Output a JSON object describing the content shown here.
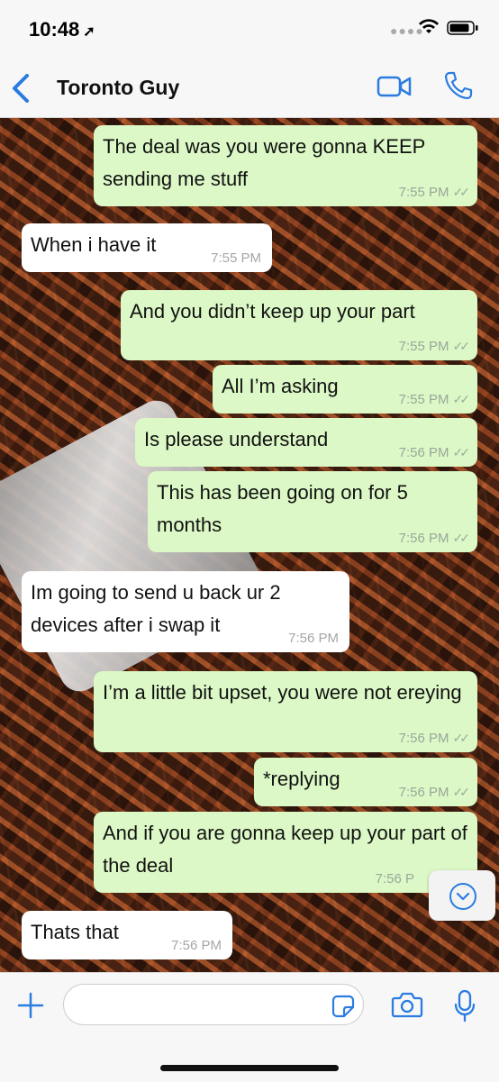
{
  "status": {
    "time": "10:48",
    "location_icon": "location-arrow-icon"
  },
  "header": {
    "title": "Toronto Guy",
    "back_icon": "chevron-left-icon",
    "video_icon": "video-call-icon",
    "call_icon": "phone-call-icon",
    "accent": "#2a7ce0"
  },
  "messages": [
    {
      "dir": "out",
      "text": "The deal was you were gonna KEEP sending me stuff",
      "time": "7:55 PM",
      "ticks": "✓✓"
    },
    {
      "dir": "in",
      "text": "When i have it",
      "time": "7:55 PM"
    },
    {
      "dir": "out",
      "text": "And you didn’t keep up your part",
      "time": "7:55 PM",
      "ticks": "✓✓"
    },
    {
      "dir": "out",
      "text": "All I’m asking",
      "time": "7:55 PM",
      "ticks": "✓✓"
    },
    {
      "dir": "out",
      "text": "Is please understand",
      "time": "7:56 PM",
      "ticks": "✓✓"
    },
    {
      "dir": "out",
      "text": "This has been going on for 5 months",
      "time": "7:56 PM",
      "ticks": "✓✓"
    },
    {
      "dir": "in",
      "text": "Im going to send u back ur 2 devices after i swap it",
      "time": "7:56 PM"
    },
    {
      "dir": "out",
      "text": "I’m a little bit upset, you were not ereying",
      "time": "7:56 PM",
      "ticks": "✓✓"
    },
    {
      "dir": "out",
      "text": "*replying",
      "time": "7:56 PM",
      "ticks": "✓✓"
    },
    {
      "dir": "out",
      "text": "And if you are gonna keep up your part of the deal",
      "time": "7:56 P"
    },
    {
      "dir": "in",
      "text": "Thats that",
      "time": "7:56 PM"
    }
  ],
  "colors": {
    "outgoing": "#dcf8c6",
    "incoming": "#ffffff",
    "accent": "#2a7ce0"
  },
  "input": {
    "placeholder": "",
    "value": ""
  }
}
